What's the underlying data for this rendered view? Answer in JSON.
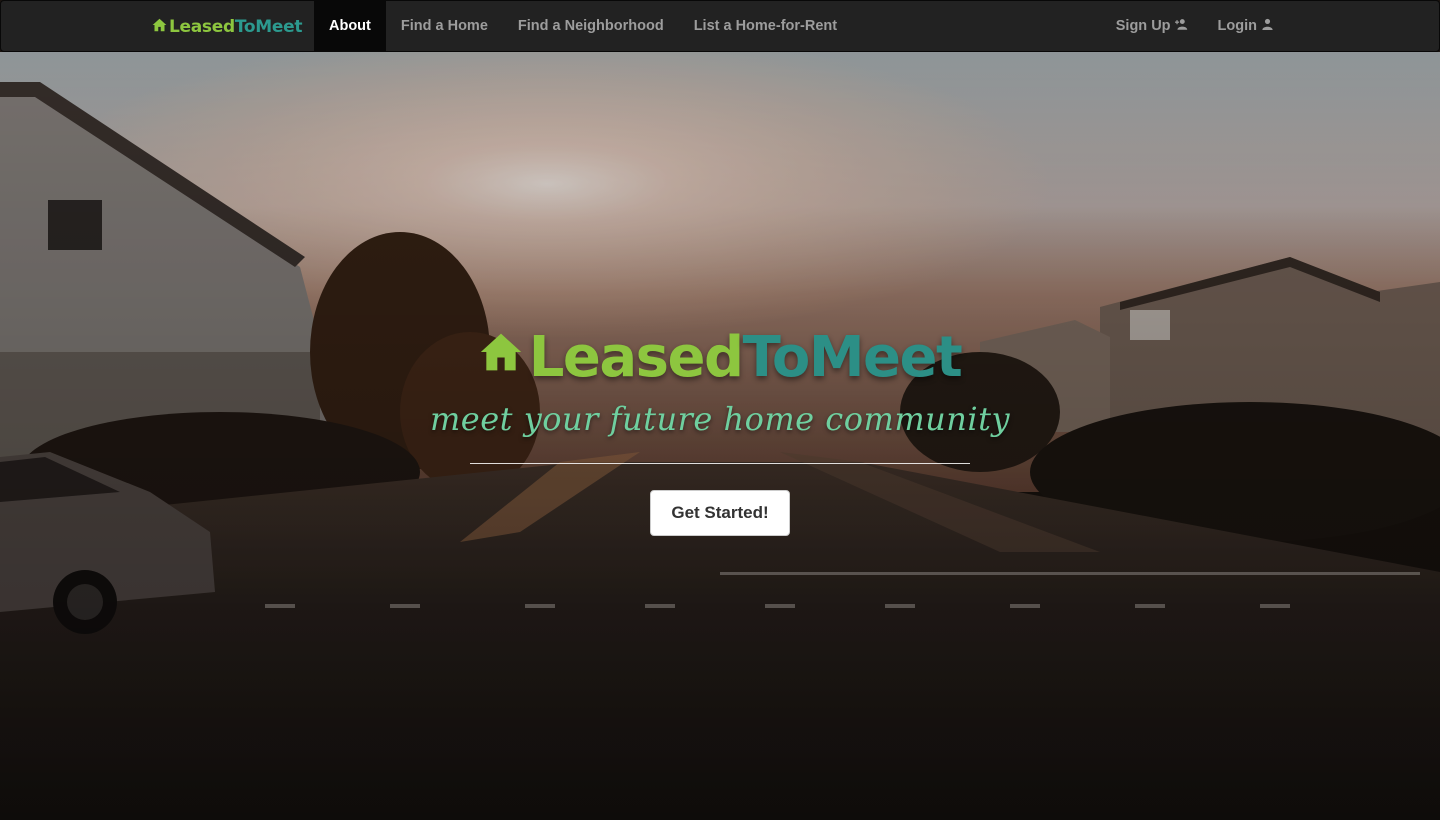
{
  "navbar": {
    "brand": {
      "part1": "Leased",
      "part2": "ToMeet",
      "icon": "house-icon"
    },
    "items": [
      {
        "label": "About",
        "active": true
      },
      {
        "label": "Find a Home",
        "active": false
      },
      {
        "label": "Find a Neighborhood",
        "active": false
      },
      {
        "label": "List a Home-for-Rent",
        "active": false
      }
    ],
    "right": {
      "signup": {
        "label": "Sign Up",
        "icon": "user-plus-icon"
      },
      "login": {
        "label": "Login",
        "icon": "user-icon"
      }
    }
  },
  "hero": {
    "logo": {
      "part1": "Leased",
      "part2": "ToMeet",
      "icon": "house-icon"
    },
    "tagline": "meet your future home community",
    "cta_label": "Get Started!"
  },
  "colors": {
    "brand_green": "#8dc63f",
    "brand_teal": "#2c9a8f",
    "tagline": "#6fcf9f",
    "navbar_bg": "#222222"
  }
}
